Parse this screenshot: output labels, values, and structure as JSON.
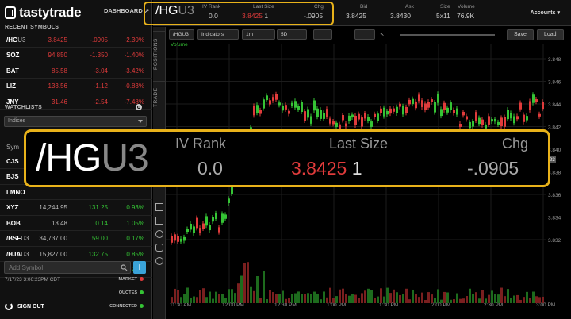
{
  "brand": {
    "name": "tastytrade",
    "dashboard": "DASHBOARD ↗"
  },
  "recent": {
    "title": "RECENT SYMBOLS",
    "rows": [
      {
        "sym": "/HG",
        "suffix": "U3",
        "last": "3.8425",
        "chg": "-.0905",
        "pct": "-2.30%",
        "dir": "red"
      },
      {
        "sym": "SOZ",
        "suffix": "",
        "last": "94.850",
        "chg": "-1.350",
        "pct": "-1.40%",
        "dir": "red"
      },
      {
        "sym": "BAT",
        "suffix": "",
        "last": "85.58",
        "chg": "-3.04",
        "pct": "-3.42%",
        "dir": "red"
      },
      {
        "sym": "LIZ",
        "suffix": "",
        "last": "133.56",
        "chg": "-1.12",
        "pct": "-0.83%",
        "dir": "red"
      },
      {
        "sym": "JNY",
        "suffix": "",
        "last": "31.46",
        "chg": "-2.54",
        "pct": "-7.48%",
        "dir": "red"
      }
    ]
  },
  "watchlists": {
    "title": "WATCHLISTS",
    "selected": "Indices",
    "col": "Sym",
    "rows": [
      {
        "sym": "CJS",
        "suffix": "",
        "last": "",
        "chg": "",
        "pct": "",
        "dir": "green"
      },
      {
        "sym": "BJS",
        "suffix": "",
        "last": "",
        "chg": "",
        "pct": "",
        "dir": "green"
      },
      {
        "sym": "LMNO",
        "suffix": "",
        "last": "",
        "chg": "",
        "pct": "",
        "dir": "green"
      },
      {
        "sym": "XYZ",
        "suffix": "",
        "last": "14,244.95",
        "chg": "131.25",
        "pct": "0.93%",
        "dir": "green"
      },
      {
        "sym": "BOB",
        "suffix": "",
        "last": "13.48",
        "chg": "0.14",
        "pct": "1.05%",
        "dir": "green"
      },
      {
        "sym": "/BSF",
        "suffix": "U3",
        "last": "34,737.00",
        "chg": "59.00",
        "pct": "0.17%",
        "dir": "green"
      },
      {
        "sym": "/HJA",
        "suffix": "U3",
        "last": "15,827.00",
        "chg": "132.75",
        "pct": "0.85%",
        "dir": "green"
      },
      {
        "sym": "/QRY",
        "suffix": "U3",
        "last": "4,549.75",
        "chg": "13.00",
        "pct": "0.29%",
        "dir": "green"
      }
    ]
  },
  "add_symbol": {
    "placeholder": "Add Symbol",
    "btn": "+"
  },
  "timestamp": "7/17/23 3:06:23PM CDT",
  "status": {
    "market": "MARKET",
    "quotes": "QUOTES",
    "connected": "CONNECTED",
    "colors": [
      "#e03b3b",
      "#35c435",
      "#35c435"
    ]
  },
  "signout": "SIGN OUT",
  "topbar": {
    "sym": "/HG",
    "suffix": "U3",
    "iv_label": "IV Rank",
    "iv": "0.0",
    "lastsize_label": "Last Size",
    "last": "3.8425",
    "size": "1",
    "chg_label": "Chg",
    "chg": "-.0905",
    "bid_label": "Bid",
    "bid": "3.8425",
    "ask_label": "Ask",
    "ask": "3.8430",
    "size2_label": "Size",
    "size2": "5x11",
    "vol_label": "Volume",
    "vol": "76.9K",
    "accounts": "Accounts ▾"
  },
  "vtabs": {
    "positions": "POSITIONS",
    "trade": "TRADE"
  },
  "chart_toolbar": {
    "symbol": "/HGU3",
    "indicators": "Indicators",
    "interval": "1m",
    "range": "5D",
    "save": "Save",
    "load": "Load"
  },
  "chart_data": {
    "type": "candlestick",
    "title": "Volume",
    "y_ticks": [
      "3.848",
      "3.846",
      "3.844",
      "3.842",
      "3.840",
      "3.838",
      "3.836",
      "3.834",
      "3.832"
    ],
    "x_ticks": [
      "11:30 AM",
      "12:00 PM",
      "12:30 PM",
      "1:00 PM",
      "1:30 PM",
      "2:00 PM",
      "2:30 PM",
      "3:00 PM"
    ],
    "ylim": [
      3.83,
      3.849
    ],
    "current_price_label": "423"
  },
  "zoom": {
    "sym": "/HG",
    "suffix": "U3",
    "iv_label": "IV Rank",
    "iv": "0.0",
    "last_label": "Last Size",
    "last": "3.8425",
    "size": "1",
    "chg_label": "Chg",
    "chg": "-.0905"
  },
  "colors": {
    "accent": "#e8b21a",
    "up": "#35c435",
    "down": "#e03b3b",
    "link": "#3aa3d8"
  }
}
